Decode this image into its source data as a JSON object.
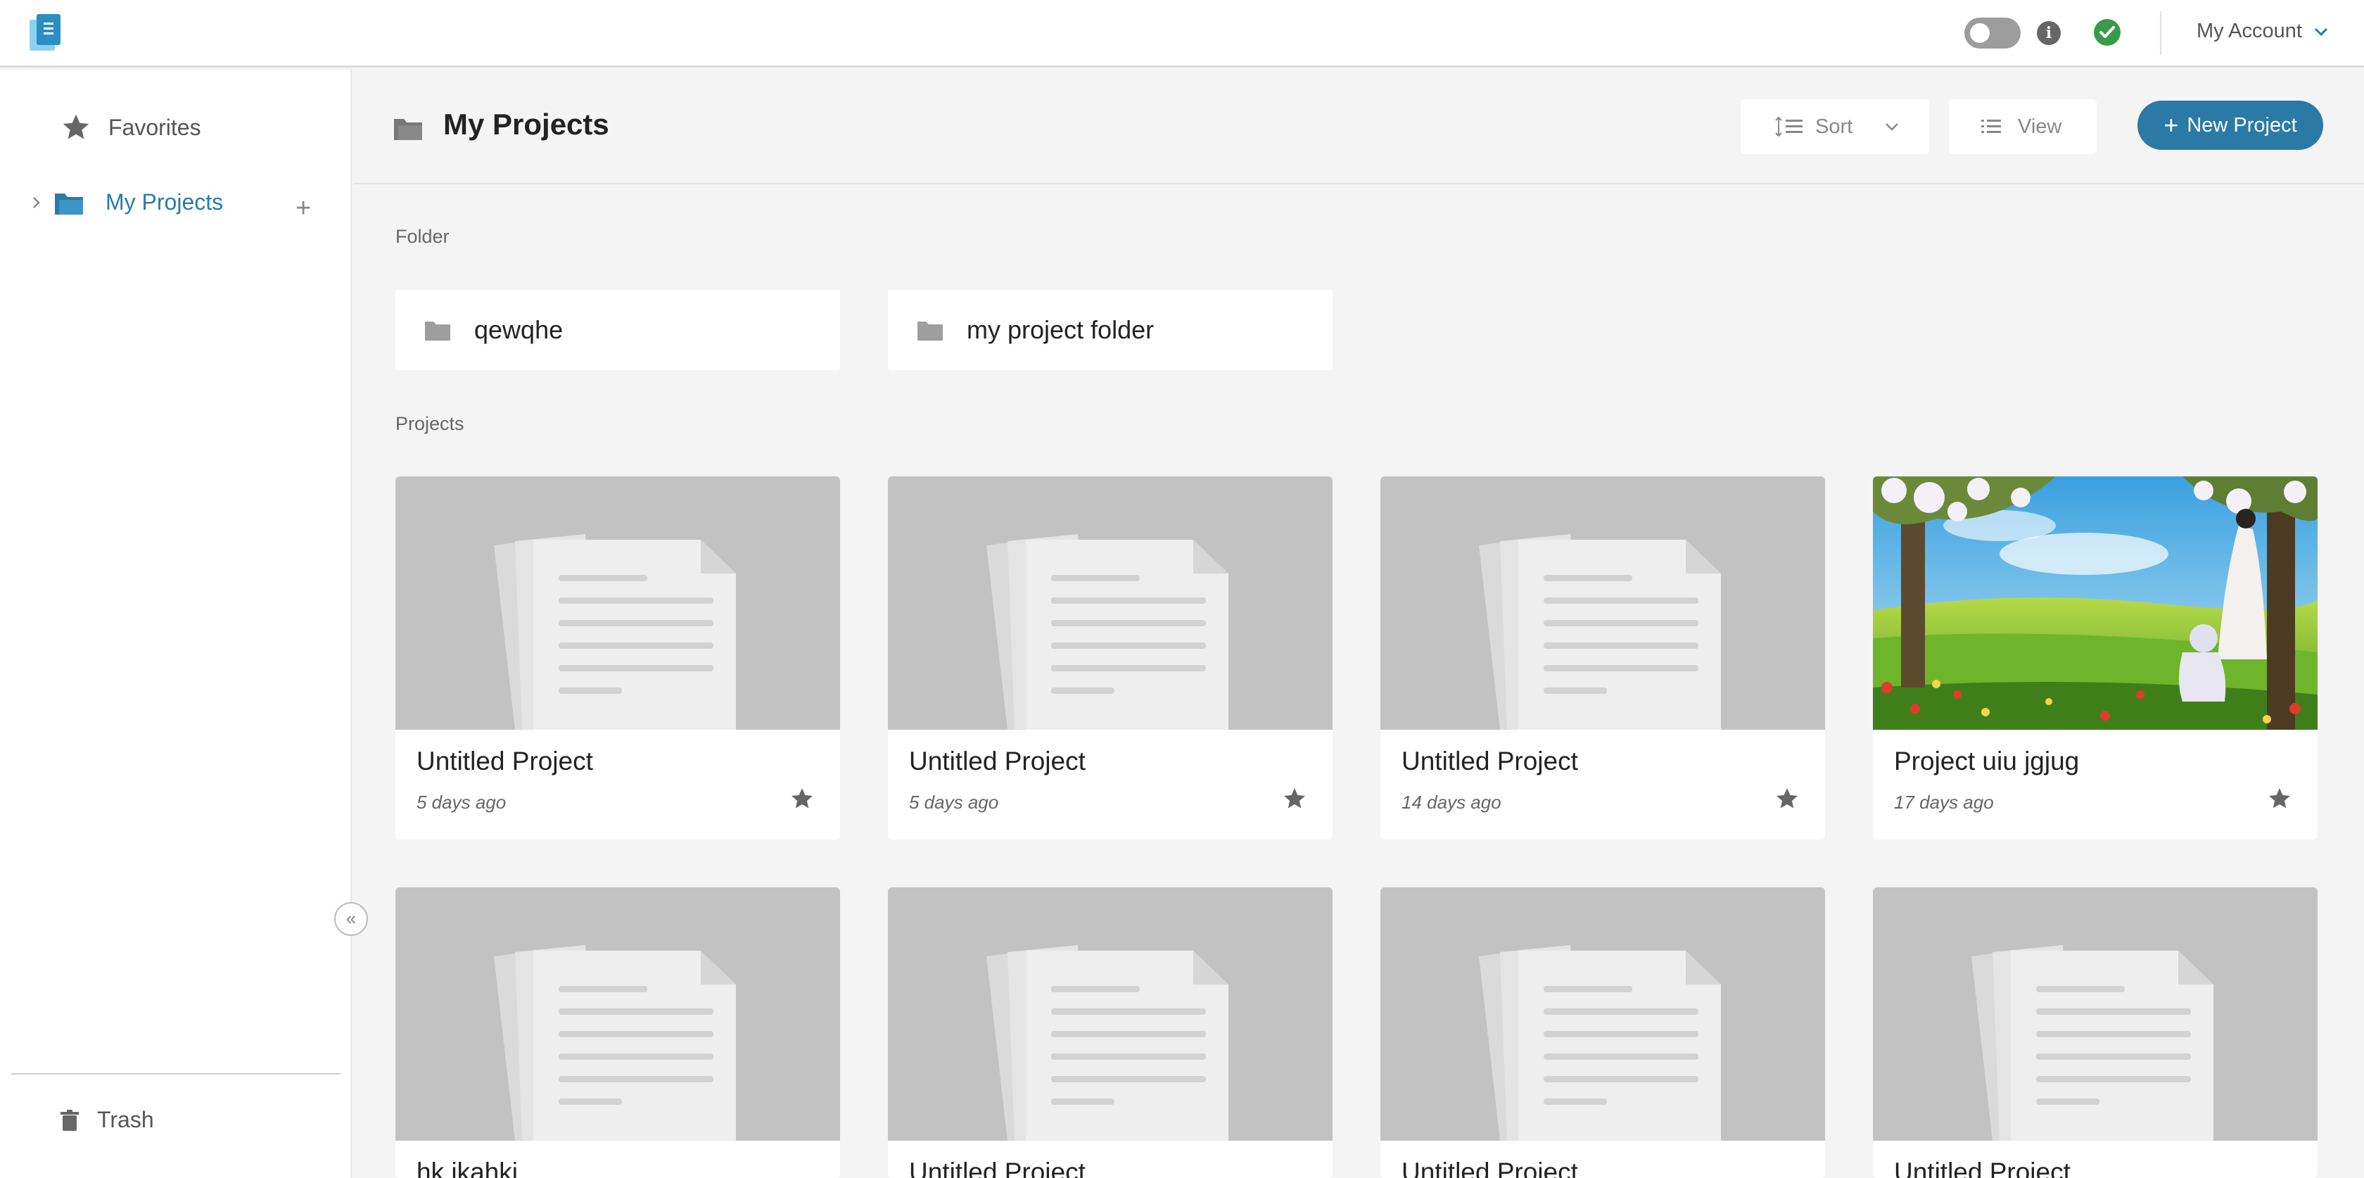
{
  "app": {
    "account_label": "My Account"
  },
  "sidebar": {
    "favorites_label": "Favorites",
    "my_projects_label": "My Projects",
    "trash_label": "Trash"
  },
  "header": {
    "title": "My Projects",
    "sort_label": "Sort",
    "view_label": "View",
    "new_project_label": "New Project"
  },
  "folders": {
    "section_label": "Folder",
    "items": [
      {
        "name": "qewqhe"
      },
      {
        "name": "my project folder"
      }
    ]
  },
  "projects": {
    "section_label": "Projects",
    "items": [
      {
        "name": "Untitled Project",
        "date": "5 days ago",
        "thumbnail": "placeholder-document"
      },
      {
        "name": "Untitled Project",
        "date": "5 days ago",
        "thumbnail": "placeholder-document"
      },
      {
        "name": "Untitled Project",
        "date": "14 days ago",
        "thumbnail": "placeholder-document"
      },
      {
        "name": "Project uiu jgjug",
        "date": "17 days ago",
        "thumbnail": "landscape-illustration"
      },
      {
        "name": "hk jkahki",
        "date": "",
        "thumbnail": "placeholder-document"
      },
      {
        "name": "Untitled Project",
        "date": "",
        "thumbnail": "placeholder-document"
      },
      {
        "name": "Untitled Project",
        "date": "",
        "thumbnail": "placeholder-document"
      },
      {
        "name": "Untitled Project",
        "date": "",
        "thumbnail": "placeholder-document"
      }
    ]
  },
  "colors": {
    "accent": "#2b7aa5",
    "status_ok": "#3a9a4a",
    "thumbnail_bg": "#c2c2c2"
  }
}
